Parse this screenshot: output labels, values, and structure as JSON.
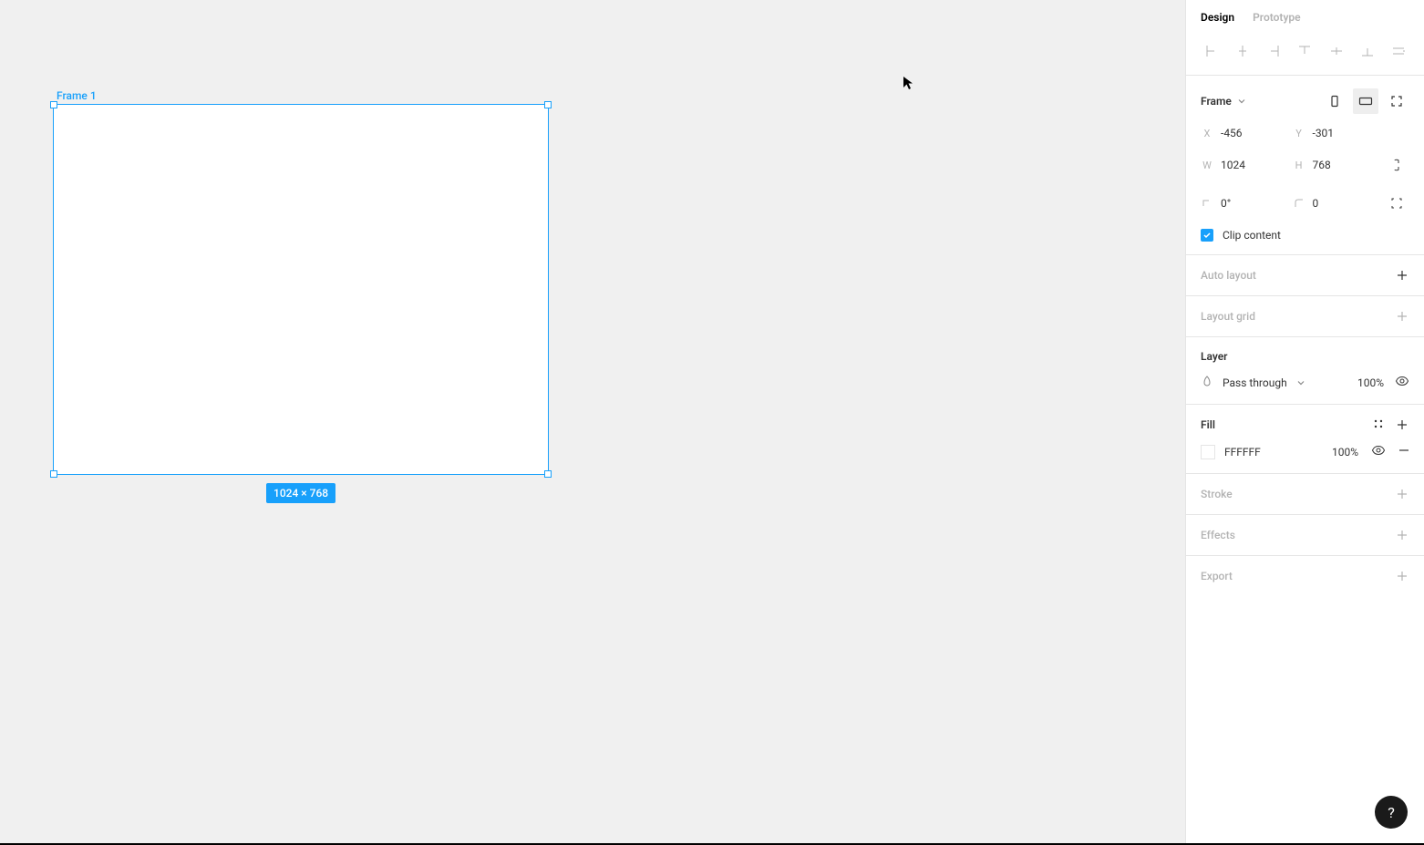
{
  "canvas": {
    "frame_label": "Frame 1",
    "dim_badge": "1024 × 768"
  },
  "tabs": {
    "design": "Design",
    "prototype": "Prototype"
  },
  "frame_section": {
    "title": "Frame",
    "x_label": "X",
    "x_value": "-456",
    "y_label": "Y",
    "y_value": "-301",
    "w_label": "W",
    "w_value": "1024",
    "h_label": "H",
    "h_value": "768",
    "rotation_value": "0°",
    "radius_value": "0",
    "clip_label": "Clip content"
  },
  "auto_layout": {
    "title": "Auto layout"
  },
  "layout_grid": {
    "title": "Layout grid"
  },
  "layer": {
    "title": "Layer",
    "blend": "Pass through",
    "opacity": "100%"
  },
  "fill": {
    "title": "Fill",
    "hex": "FFFFFF",
    "opacity": "100%"
  },
  "stroke": {
    "title": "Stroke"
  },
  "effects": {
    "title": "Effects"
  },
  "export": {
    "title": "Export"
  },
  "help": "?"
}
